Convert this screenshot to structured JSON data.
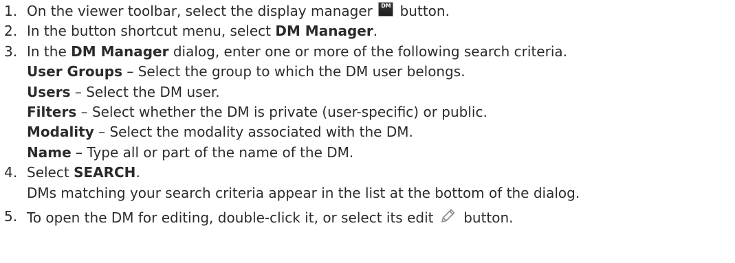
{
  "steps": [
    {
      "number": "1.",
      "text_before": "On the viewer toolbar, select the display manager ",
      "icon_label": "DM",
      "text_after": " button."
    },
    {
      "number": "2.",
      "text_before": "In the button shortcut menu, select ",
      "bold": "DM Manager",
      "text_after": "."
    },
    {
      "number": "3.",
      "text_before": "In the ",
      "bold": "DM Manager",
      "text_after": " dialog, enter one or more of the following search criteria.",
      "criteria": [
        {
          "term": "User Groups",
          "desc": " – Select the group to which the DM user belongs."
        },
        {
          "term": "Users",
          "desc": " – Select the DM user."
        },
        {
          "term": "Filters",
          "desc": " – Select whether the DM is private (user-specific) or public."
        },
        {
          "term": "Modality",
          "desc": " – Select the modality associated with the DM."
        },
        {
          "term": "Name",
          "desc": " – Type all or part of the name of the DM."
        }
      ]
    },
    {
      "number": "4.",
      "text_before": "Select ",
      "bold": "SEARCH",
      "text_after": ".",
      "result": "DMs matching your search criteria appear in the list at the bottom of the dialog."
    },
    {
      "number": "5.",
      "text_before": "To open the DM for editing, double-click it, or select its edit ",
      "text_after": " button."
    }
  ]
}
